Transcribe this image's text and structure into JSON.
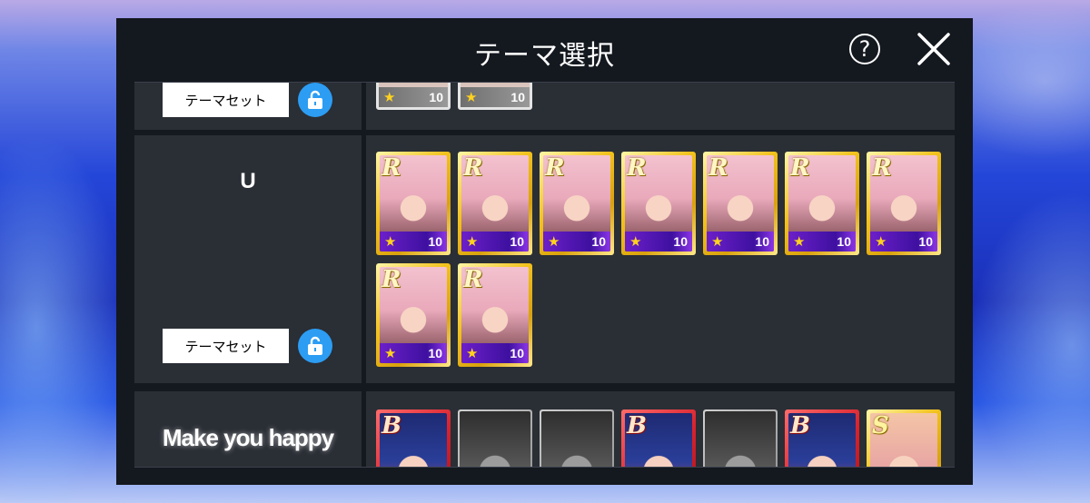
{
  "dialog": {
    "title": "テーマ選択",
    "help_label": "?",
    "close_icon": "close-icon",
    "help_icon": "question-icon"
  },
  "themes": [
    {
      "name": "",
      "set_button": "テーマセット",
      "lock_icon": "unlock-icon",
      "cards": [
        {
          "rank": "",
          "level": "10",
          "style": "partial"
        },
        {
          "rank": "",
          "level": "10",
          "style": "partial"
        }
      ]
    },
    {
      "name": "U",
      "set_button": "テーマセット",
      "lock_icon": "unlock-icon",
      "cards": [
        {
          "rank": "R",
          "level": "10",
          "style": "gold"
        },
        {
          "rank": "R",
          "level": "10",
          "style": "gold"
        },
        {
          "rank": "R",
          "level": "10",
          "style": "gold"
        },
        {
          "rank": "R",
          "level": "10",
          "style": "gold"
        },
        {
          "rank": "R",
          "level": "10",
          "style": "gold"
        },
        {
          "rank": "R",
          "level": "10",
          "style": "gold"
        },
        {
          "rank": "R",
          "level": "10",
          "style": "gold"
        },
        {
          "rank": "R",
          "level": "10",
          "style": "gold"
        },
        {
          "rank": "R",
          "level": "10",
          "style": "gold"
        }
      ]
    },
    {
      "name": "Make you happy",
      "cards": [
        {
          "rank": "B",
          "style": "red"
        },
        {
          "rank": "",
          "style": "grey"
        },
        {
          "rank": "",
          "style": "grey"
        },
        {
          "rank": "B",
          "style": "red"
        },
        {
          "rank": "",
          "style": "grey"
        },
        {
          "rank": "B",
          "style": "red"
        },
        {
          "rank": "S",
          "style": "gold"
        }
      ]
    }
  ],
  "colors": {
    "panel": "#2a2e35",
    "modal_bg": "#14181f",
    "lock_button": "#2c9df3",
    "card_footer": "#6c1fc9",
    "star": "#ffd21e"
  }
}
